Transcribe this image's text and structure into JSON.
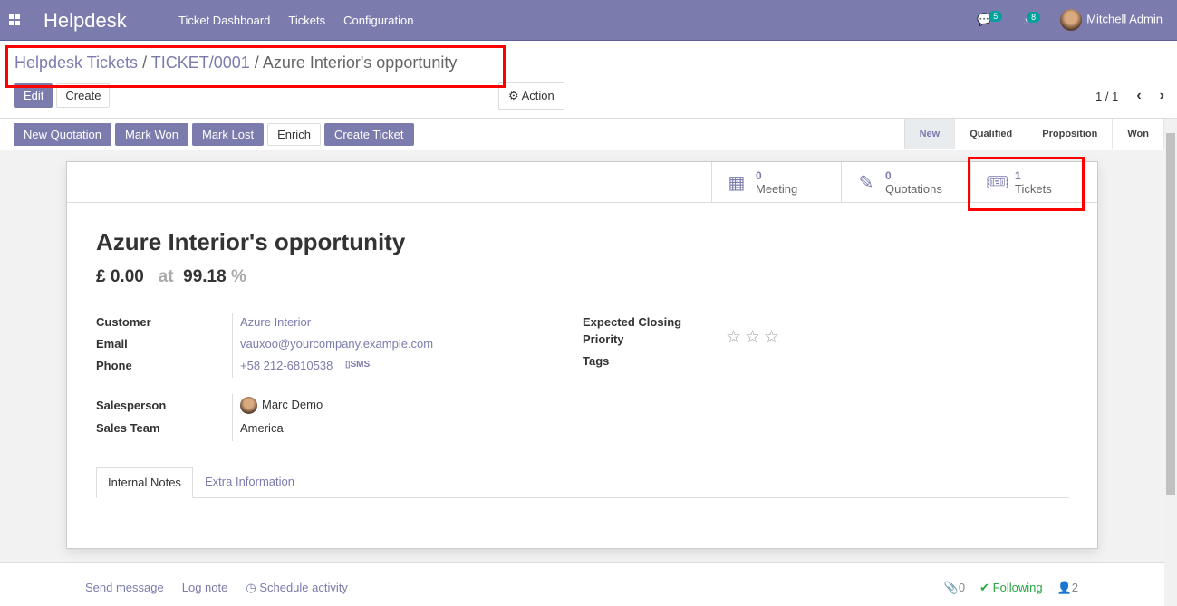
{
  "navbar": {
    "brand": "Helpdesk",
    "menu": [
      "Ticket Dashboard",
      "Tickets",
      "Configuration"
    ],
    "messages_count": "5",
    "activities_count": "8",
    "user": "Mitchell Admin"
  },
  "breadcrumb": {
    "root": "Helpdesk Tickets",
    "ticket": "TICKET/0001",
    "current": "Azure Interior's opportunity"
  },
  "control": {
    "edit": "Edit",
    "create": "Create",
    "action": "Action",
    "pager": "1 / 1"
  },
  "header_buttons": [
    "New Quotation",
    "Mark Won",
    "Mark Lost",
    "Enrich",
    "Create Ticket"
  ],
  "stages": [
    "New",
    "Qualified",
    "Proposition",
    "Won"
  ],
  "smart_buttons": {
    "meeting": {
      "count": "0",
      "label": "Meeting"
    },
    "quotations": {
      "count": "0",
      "label": "Quotations"
    },
    "tickets": {
      "count": "1",
      "label": "Tickets"
    }
  },
  "record": {
    "title": "Azure Interior's opportunity",
    "revenue": "£ 0.00",
    "at": "at",
    "probability": "99.18",
    "pct": "%"
  },
  "fields": {
    "customer_label": "Customer",
    "customer": "Azure Interior",
    "email_label": "Email",
    "email": "vauxoo@yourcompany.example.com",
    "phone_label": "Phone",
    "phone": "+58 212-6810538",
    "sms": "SMS",
    "salesperson_label": "Salesperson",
    "salesperson": "Marc Demo",
    "team_label": "Sales Team",
    "team": "America",
    "closing_label": "Expected Closing",
    "priority_label": "Priority",
    "tags_label": "Tags",
    "priority_stars": 0
  },
  "tabs": [
    "Internal Notes",
    "Extra Information"
  ],
  "chatter": {
    "send": "Send message",
    "log": "Log note",
    "schedule": "Schedule activity",
    "attachments": "0",
    "following": "Following",
    "followers": "2"
  }
}
